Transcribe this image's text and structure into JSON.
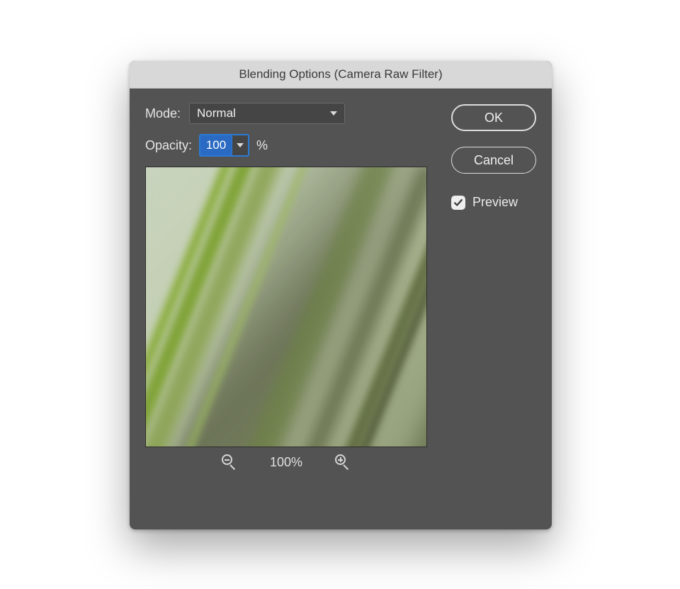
{
  "dialog": {
    "title": "Blending Options (Camera Raw Filter)"
  },
  "mode": {
    "label": "Mode:",
    "value": "Normal"
  },
  "opacity": {
    "label": "Opacity:",
    "value": "100",
    "unit": "%"
  },
  "zoom": {
    "level": "100%"
  },
  "buttons": {
    "ok": "OK",
    "cancel": "Cancel"
  },
  "preview": {
    "label": "Preview",
    "checked": true
  }
}
